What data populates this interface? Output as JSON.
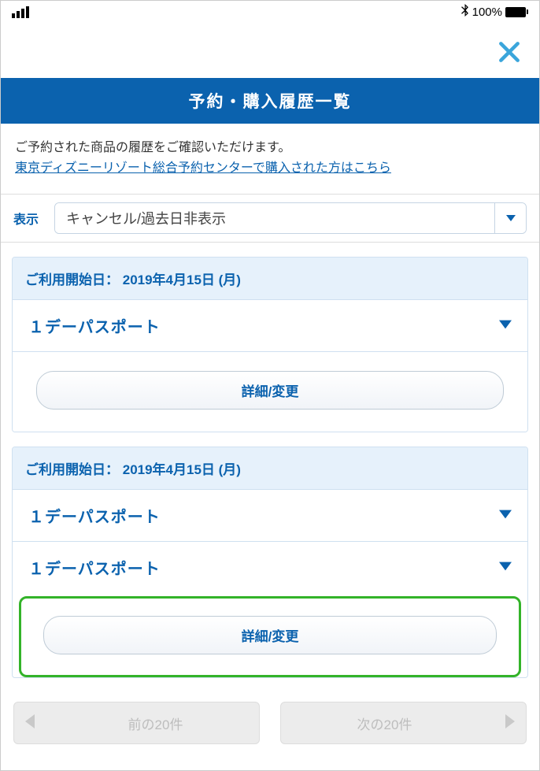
{
  "status": {
    "bluetooth_icon": "bluetooth",
    "battery_text": "100%"
  },
  "header": {
    "title": "予約・購入履歴一覧"
  },
  "intro": {
    "text": "ご予約された商品の履歴をご確認いただけます。",
    "link_text": "東京ディズニーリゾート総合予約センターで購入された方はこちら"
  },
  "filter": {
    "label": "表示",
    "selected": "キャンセル/過去日非表示"
  },
  "bookings": [
    {
      "date_label": "ご利用開始日：",
      "date_value": "2019年4月15日 (月)",
      "items": [
        {
          "title": "１デーパスポート"
        }
      ],
      "action_label": "詳細/変更",
      "highlighted": false
    },
    {
      "date_label": "ご利用開始日：",
      "date_value": "2019年4月15日 (月)",
      "items": [
        {
          "title": "１デーパスポート"
        },
        {
          "title": "１デーパスポート"
        }
      ],
      "action_label": "詳細/変更",
      "highlighted": true
    }
  ],
  "pager": {
    "prev_label": "前の20件",
    "next_label": "次の20件"
  }
}
